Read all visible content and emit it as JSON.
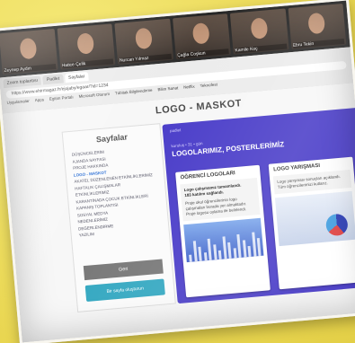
{
  "zoom": {
    "participants": [
      "Zeynep Aydın",
      "Hatice Çelik",
      "Nurcan Yılmaz",
      "Çağla Coşkun",
      "Kamile Koç",
      "Ebru Tekin"
    ]
  },
  "browser": {
    "tabs": [
      "Zoom toplantısı",
      "Padlet",
      "Sayfalar"
    ],
    "address": "https://www.ehirmagaz.fr/ejojaby/egaar/?id=1234",
    "bookmarks": [
      "Uygulamalar",
      "Apps",
      "Egitim Portalı",
      "Microsoft Oturum",
      "Tübitak Bilgilendirme",
      "Bilim Sanat",
      "Netflix",
      "Teknofest"
    ]
  },
  "page": {
    "title": "LOGO - MASKOT",
    "sidebar": {
      "title": "Sayfalar",
      "items": [
        "DÜŞÜNCELERİM",
        "AJANDA SAYFASI",
        "PROJE HAKKINDA",
        "LOGO - MASKOT",
        "AKATEL DÜZENLENEN ETKİNLİKLERİMİZ",
        "HAFTALIK ÇALIŞMALAR",
        "ETKİNLİKLERİMİZ",
        "KARANTİNADA ÇOCUK ETKİNLİKLERİ",
        "KAPANIŞ TOPLANTISI",
        "SOSYAL MEDYA",
        "NEDENLERİMİZ",
        "DEĞERLENDİRME",
        "YAZILIM"
      ],
      "active_index": 3,
      "btn_gray": "Geri",
      "btn_teal": "Bir sayfa oluşturun"
    },
    "padlet": {
      "top": "padlet",
      "crumb": "kuruluş • 31 • gün",
      "title": "LOGOLARIMIZ, POSTERLERİMİZ",
      "col1": {
        "header": "ÖĞRENCİ LOGOLARI",
        "card_bold": "Logo çalışmamız tamamlandı.",
        "card_bold2": "183 katılım sağlandı.",
        "card_text": "Proje okul öğrencilerinin logo çalışmaları burada yer almaktadır. Proje logosu oylama ile belirlendi."
      },
      "col2": {
        "header": "LOGO YARIŞMASI",
        "card_text": "Logo yarışması sonuçları açıklandı. Tüm öğrencilerimizi kutlarız."
      }
    }
  },
  "colors": {
    "padlet": "#4b3ec9",
    "teal": "#37a9c2",
    "background": "#f2e36a"
  }
}
